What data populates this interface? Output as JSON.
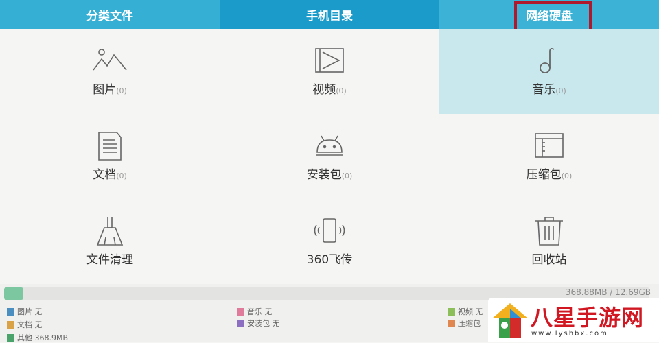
{
  "tabs": [
    {
      "label": "分类文件"
    },
    {
      "label": "手机目录"
    },
    {
      "label": "网络硬盘"
    }
  ],
  "categories": [
    {
      "label": "图片",
      "count": "(0)",
      "icon": "image-icon"
    },
    {
      "label": "视频",
      "count": "(0)",
      "icon": "video-icon"
    },
    {
      "label": "音乐",
      "count": "(0)",
      "icon": "music-icon"
    },
    {
      "label": "文档",
      "count": "(0)",
      "icon": "document-icon"
    },
    {
      "label": "安装包",
      "count": "(0)",
      "icon": "android-icon"
    },
    {
      "label": "压缩包",
      "count": "(0)",
      "icon": "archive-icon"
    },
    {
      "label": "文件清理",
      "count": "",
      "icon": "broom-icon"
    },
    {
      "label": "360飞传",
      "count": "",
      "icon": "phone-transfer-icon"
    },
    {
      "label": "回收站",
      "count": "",
      "icon": "trash-icon"
    }
  ],
  "storage": {
    "capacity": "368.88MB / 12.69GB",
    "used_fraction": 0.03,
    "legend": [
      {
        "label": "图片 无",
        "color": "#4a8fc0"
      },
      {
        "label": "音乐 无",
        "color": "#e07b9b"
      },
      {
        "label": "视频 无",
        "color": "#8cbf5a"
      },
      {
        "label": "文档 无",
        "color": "#d9a246"
      },
      {
        "label": "安装包 无",
        "color": "#8c6fc1"
      },
      {
        "label": "压缩包",
        "color": "#e0874f"
      },
      {
        "label": "其他 368.9MB",
        "color": "#4aa36a"
      }
    ]
  },
  "watermark": {
    "text": "八星手游网",
    "url": "www.lyshbx.com"
  }
}
